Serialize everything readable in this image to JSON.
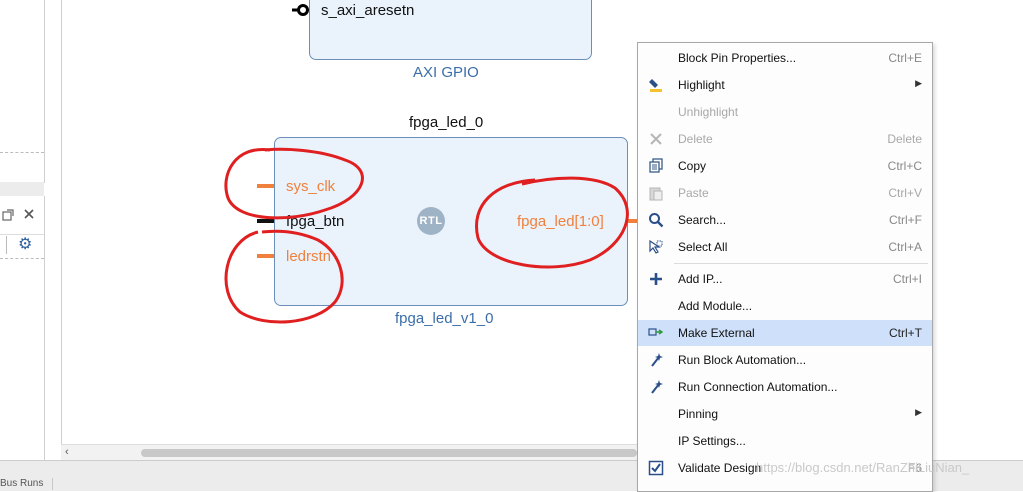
{
  "axi_gpio": {
    "pin_label": "s_axi_aresetn",
    "caption": "AXI GPIO"
  },
  "fpga_led": {
    "instance_name": "fpga_led_0",
    "module_caption": "fpga_led_v1_0",
    "badge": "RTL",
    "inputs": [
      "sys_clk",
      "fpga_btn",
      "ledrstn"
    ],
    "output": "fpga_led[1:0]"
  },
  "left_panel": {
    "float_icon": "float-icon",
    "close_icon": "close-icon",
    "settings_icon": "gear-icon"
  },
  "bottom_tab_label": "Bus Runs",
  "context_menu": {
    "items": [
      {
        "label": "Block Pin Properties...",
        "shortcut": "Ctrl+E",
        "icon": "",
        "disabled": false
      },
      {
        "label": "Highlight",
        "shortcut": "",
        "icon": "highlight-icon",
        "submenu": true,
        "disabled": false
      },
      {
        "label": "Unhighlight",
        "shortcut": "",
        "icon": "",
        "disabled": true
      },
      {
        "label": "Delete",
        "shortcut": "Delete",
        "icon": "delete-icon",
        "disabled": true
      },
      {
        "label": "Copy",
        "shortcut": "Ctrl+C",
        "icon": "copy-icon",
        "disabled": false
      },
      {
        "label": "Paste",
        "shortcut": "Ctrl+V",
        "icon": "paste-icon",
        "disabled": true
      },
      {
        "label": "Search...",
        "shortcut": "Ctrl+F",
        "icon": "search-icon",
        "disabled": false
      },
      {
        "label": "Select All",
        "shortcut": "Ctrl+A",
        "icon": "select-all-icon",
        "disabled": false
      },
      {
        "label": "Add IP...",
        "shortcut": "Ctrl+I",
        "icon": "add-icon",
        "disabled": false
      },
      {
        "label": "Add Module...",
        "shortcut": "",
        "icon": "",
        "disabled": false
      },
      {
        "label": "Make External",
        "shortcut": "Ctrl+T",
        "icon": "make-external-icon",
        "disabled": false,
        "selected": true
      },
      {
        "label": "Run Block Automation...",
        "shortcut": "",
        "icon": "wand-icon",
        "disabled": false
      },
      {
        "label": "Run Connection Automation...",
        "shortcut": "",
        "icon": "wand-icon",
        "disabled": false
      },
      {
        "label": "Pinning",
        "shortcut": "",
        "icon": "",
        "submenu": true,
        "disabled": false
      },
      {
        "label": "IP Settings...",
        "shortcut": "",
        "icon": "",
        "disabled": false
      },
      {
        "label": "Validate Design",
        "shortcut": "F6",
        "icon": "validate-icon",
        "disabled": false
      }
    ]
  },
  "watermark": "https://blog.csdn.net/RanZhiLiuNian_",
  "colors": {
    "block_fill": "#eaf3fc",
    "block_border": "#6b8fb8",
    "caption_blue": "#3b6ea8",
    "pin_orange": "#f0803c",
    "annotation_red": "#e02020",
    "menu_highlight": "#cfe0fa"
  }
}
